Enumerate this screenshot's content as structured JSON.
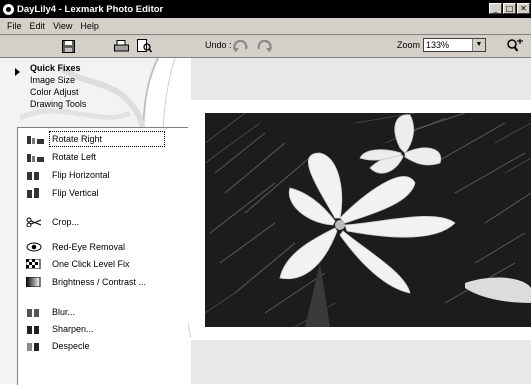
{
  "window": {
    "title": "DayLily4 - Lexmark Photo Editor",
    "buttons": [
      "_",
      "□",
      "✕"
    ]
  },
  "menu": [
    "File",
    "Edit",
    "View",
    "Help"
  ],
  "toolbar": {
    "undo_label": "Undo :",
    "zoom_label": "Zoom :",
    "zoom_value": "133%"
  },
  "nav": {
    "items": [
      {
        "label": "Quick Fixes",
        "selected": true
      },
      {
        "label": "Image Size"
      },
      {
        "label": "Color Adjust"
      },
      {
        "label": "Drawing Tools"
      }
    ]
  },
  "tools": [
    {
      "label": "Rotate Right",
      "icon": "rotate-right-icon"
    },
    {
      "label": "Rotate Left",
      "icon": "rotate-left-icon"
    },
    {
      "label": "Flip Horizontal",
      "icon": "flip-horizontal-icon"
    },
    {
      "label": "Flip Vertical",
      "icon": "flip-vertical-icon"
    },
    {
      "label": "Crop...",
      "icon": "scissors-icon"
    },
    {
      "label": "Red-Eye Removal",
      "icon": "eye-icon"
    },
    {
      "label": "One Click Level Fix",
      "icon": "checkerboard-icon"
    },
    {
      "label": "Brightness / Contrast ...",
      "icon": "gradient-icon"
    },
    {
      "label": "Blur...",
      "icon": "blur-icon"
    },
    {
      "label": "Sharpen...",
      "icon": "sharpen-icon"
    },
    {
      "label": "Despecle",
      "icon": "despeckle-icon"
    }
  ]
}
